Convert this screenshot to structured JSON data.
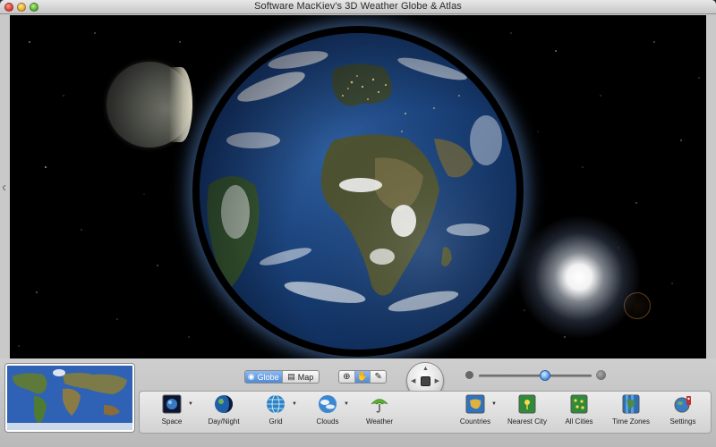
{
  "window": {
    "title": "Software MacKiev's 3D Weather Globe & Atlas"
  },
  "view_toggle": {
    "globe_label": "Globe",
    "map_label": "Map",
    "selected": "Globe"
  },
  "zoom": {
    "level_fraction": 0.59
  },
  "toolbar": {
    "tools": [
      {
        "label": "Space",
        "icon": "space-icon",
        "has_menu": true
      },
      {
        "label": "Day/Night",
        "icon": "day-night-icon",
        "has_menu": false
      },
      {
        "label": "Grid",
        "icon": "grid-globe-icon",
        "has_menu": true
      },
      {
        "label": "Clouds",
        "icon": "clouds-globe-icon",
        "has_menu": true
      },
      {
        "label": "Weather",
        "icon": "umbrella-icon",
        "has_menu": false
      },
      {
        "label": "Countries",
        "icon": "countries-icon",
        "has_menu": true
      },
      {
        "label": "Nearest City",
        "icon": "nearest-city-icon",
        "has_menu": false
      },
      {
        "label": "All Cities",
        "icon": "all-cities-icon",
        "has_menu": false
      },
      {
        "label": "Time Zones",
        "icon": "time-zones-icon",
        "has_menu": false
      },
      {
        "label": "Settings",
        "icon": "settings-icon",
        "has_menu": false
      }
    ]
  },
  "colors": {
    "accent": "#4f8ad9",
    "space": "#000000",
    "ocean": "#1d4680"
  }
}
